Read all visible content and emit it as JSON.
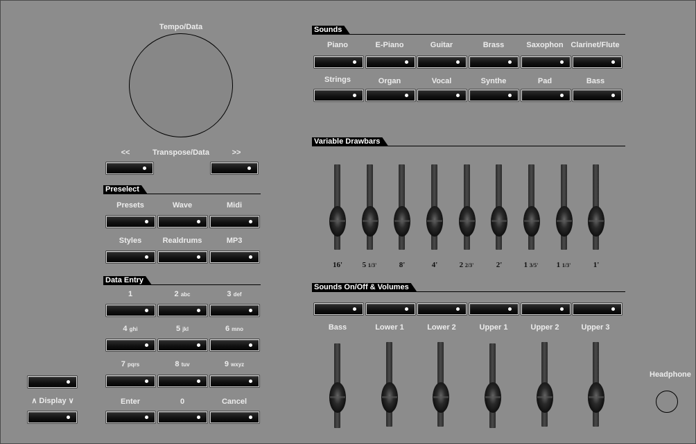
{
  "tempo_data": {
    "label": "Tempo/Data"
  },
  "transpose": {
    "prev": "<<",
    "label": "Transpose/Data",
    "next": ">>"
  },
  "preselect": {
    "title": "Preselect",
    "row1": [
      "Presets",
      "Wave",
      "Midi"
    ],
    "row2": [
      "Styles",
      "Realdrums",
      "MP3"
    ]
  },
  "data_entry": {
    "title": "Data Entry",
    "row1": [
      {
        "d": "1",
        "l": ""
      },
      {
        "d": "2",
        "l": "abc"
      },
      {
        "d": "3",
        "l": "def"
      }
    ],
    "row2": [
      {
        "d": "4",
        "l": "ghi"
      },
      {
        "d": "5",
        "l": "jkl"
      },
      {
        "d": "6",
        "l": "mno"
      }
    ],
    "row3": [
      {
        "d": "7",
        "l": "pqrs"
      },
      {
        "d": "8",
        "l": "tuv"
      },
      {
        "d": "9",
        "l": "wxyz"
      }
    ],
    "row4": [
      "Enter",
      "0",
      "Cancel"
    ]
  },
  "display": {
    "label": "∧ Display ∨"
  },
  "sounds": {
    "title": "Sounds",
    "row1": [
      "Piano",
      "E-Piano",
      "Guitar",
      "Brass",
      "Saxophon",
      "Clarinet/Flute"
    ],
    "row2": [
      "Strings",
      "Organ",
      "Vocal",
      "Synthe",
      "Pad",
      "Bass"
    ]
  },
  "drawbars": {
    "title": "Variable Drawbars",
    "footages": [
      {
        "w": "16'",
        "f": ""
      },
      {
        "w": "5",
        "f": "1/3'"
      },
      {
        "w": "8'",
        "f": ""
      },
      {
        "w": "4'",
        "f": ""
      },
      {
        "w": "2",
        "f": "2/3'"
      },
      {
        "w": "2'",
        "f": ""
      },
      {
        "w": "1",
        "f": "3/5'"
      },
      {
        "w": "1",
        "f": "1/3'"
      },
      {
        "w": "1'",
        "f": ""
      }
    ]
  },
  "volumes": {
    "title": "Sounds On/Off & Volumes",
    "labels": [
      "Bass",
      "Lower 1",
      "Lower 2",
      "Upper 1",
      "Upper 2",
      "Upper 3"
    ]
  },
  "headphone": {
    "label": "Headphone"
  },
  "colors": {
    "panel": "#8c8c8c",
    "button": "#111111",
    "led": "#ffffff",
    "section_tab": "#000000"
  }
}
